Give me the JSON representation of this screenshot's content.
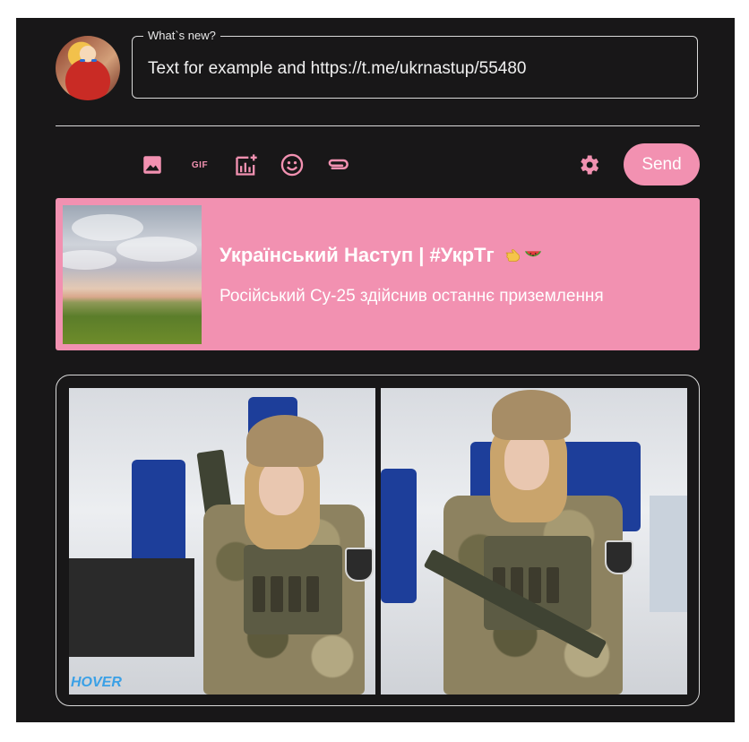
{
  "composer": {
    "legend": "What`s new?",
    "input_value": "Text for example and https://t.me/ukrnastup/55480"
  },
  "toolbar": {
    "icons": [
      "image-icon",
      "gif-icon",
      "poll-icon",
      "emoji-icon",
      "attach-icon",
      "settings-icon"
    ],
    "gif_label": "GIF",
    "send_label": "Send"
  },
  "link_preview": {
    "title": "Український Наступ | #УкрТг",
    "description": "Російський Су-25 здійснив останнє приземлення"
  },
  "hover_logo": "HOVER",
  "colors": {
    "background": "#181718",
    "accent": "#f291b1",
    "text": "#ffffff",
    "border": "#d9d9d9"
  }
}
